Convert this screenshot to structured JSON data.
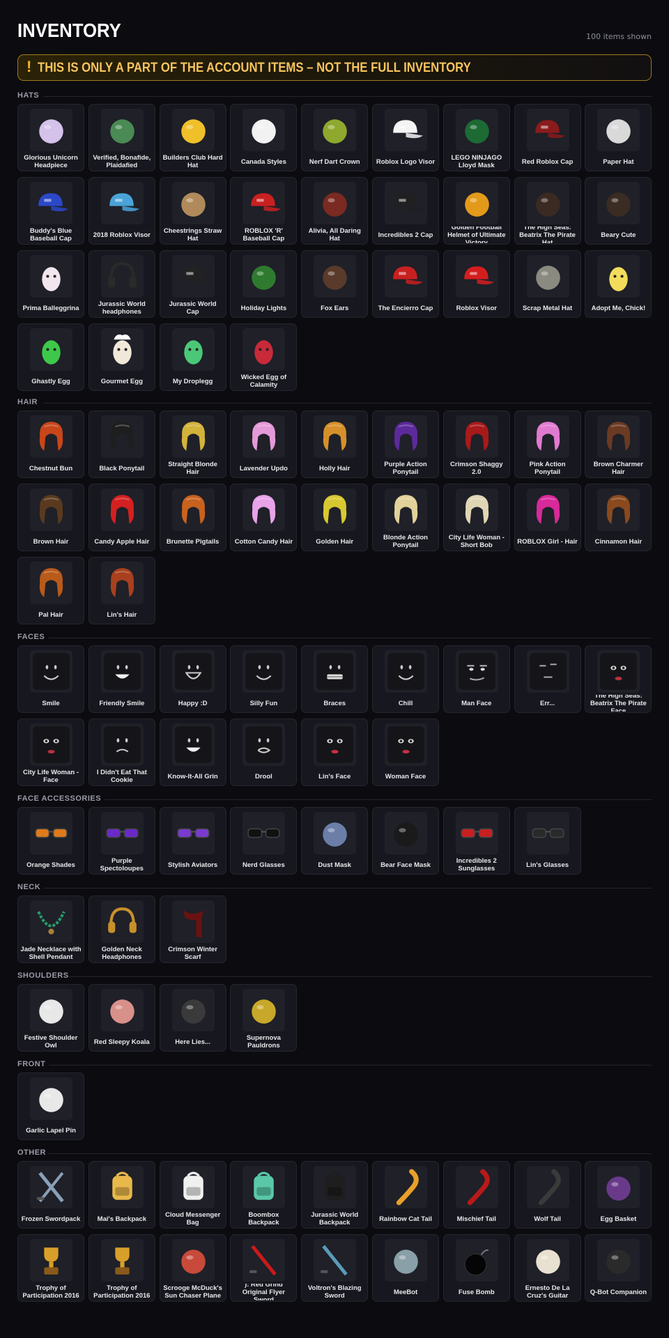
{
  "header": {
    "title": "INVENTORY",
    "count_text": "100 items shown"
  },
  "banner": {
    "icon": "!",
    "text": "THIS IS ONLY A PART OF THE ACCOUNT ITEMS – NOT THE FULL INVENTORY"
  },
  "sections": [
    {
      "title": "HATS",
      "items": [
        {
          "name": "Glorious Unicorn Headpiece",
          "icon": "unicorn-headpiece-icon",
          "color": "#d4c2ea"
        },
        {
          "name": "Verified, Bonafide, Plaidafied",
          "icon": "plaid-cap-icon",
          "color": "#4a8a54"
        },
        {
          "name": "Builders Club Hard Hat",
          "icon": "hard-hat-icon",
          "color": "#f0c02a"
        },
        {
          "name": "Canada Styles",
          "icon": "canada-cap-icon",
          "color": "#f2f2f2"
        },
        {
          "name": "Nerf Dart Crown",
          "icon": "crown-icon",
          "color": "#8fa82e"
        },
        {
          "name": "Roblox Logo Visor",
          "icon": "visor-icon",
          "color": "#f4f4f4"
        },
        {
          "name": "LEGO NINJAGO Lloyd Mask",
          "icon": "mask-icon",
          "color": "#1d6a34"
        },
        {
          "name": "Red Roblox Cap",
          "icon": "cap-icon",
          "color": "#8a1b1b"
        },
        {
          "name": "Paper Hat",
          "icon": "paper-hat-icon",
          "color": "#d9d9d9"
        },
        {
          "name": "Buddy's Blue Baseball Cap",
          "icon": "cap-icon",
          "color": "#2b48c8"
        },
        {
          "name": "2018 Roblox Visor",
          "icon": "visor-icon",
          "color": "#4aa3d8"
        },
        {
          "name": "Cheestrings Straw Hat",
          "icon": "straw-hat-icon",
          "color": "#b08a5a"
        },
        {
          "name": "ROBLOX 'R' Baseball Cap",
          "icon": "cap-icon",
          "color": "#c92020"
        },
        {
          "name": "Alivia, All Daring Hat",
          "icon": "hat-icon",
          "color": "#7a2a20"
        },
        {
          "name": "Incredibles 2 Cap",
          "icon": "cap-icon",
          "color": "#202020"
        },
        {
          "name": "Golden Football Helmet of Ultimate Victory",
          "icon": "helmet-icon",
          "color": "#e39a1a"
        },
        {
          "name": "The High Seas: Beatrix The Pirate Hat",
          "icon": "pirate-hat-icon",
          "color": "#3a2a22"
        },
        {
          "name": "Beary Cute",
          "icon": "bear-hat-icon",
          "color": "#3a2c22"
        },
        {
          "name": "Prima Balleggrina",
          "icon": "egg-icon",
          "color": "#f2e6ee"
        },
        {
          "name": "Jurassic World headphones",
          "icon": "headphones-icon",
          "color": "#2a2a2a"
        },
        {
          "name": "Jurassic World Cap",
          "icon": "cap-icon",
          "color": "#222222"
        },
        {
          "name": "Holiday Lights",
          "icon": "lights-icon",
          "color": "#2e7a2e"
        },
        {
          "name": "Fox Ears",
          "icon": "fox-ears-icon",
          "color": "#5a3a2a"
        },
        {
          "name": "The Encierro Cap",
          "icon": "cap-icon",
          "color": "#c82020"
        },
        {
          "name": "Roblox Visor",
          "icon": "visor-icon",
          "color": "#d41e1e"
        },
        {
          "name": "Scrap Metal Hat",
          "icon": "scrap-hat-icon",
          "color": "#8a8a80"
        },
        {
          "name": "Adopt Me, Chick!",
          "icon": "chick-icon",
          "color": "#f2dc5a"
        },
        {
          "name": "Ghastly Egg",
          "icon": "egg-icon",
          "color": "#3ec84a"
        },
        {
          "name": "Gourmet Egg",
          "icon": "chef-egg-icon",
          "color": "#f0e8d8"
        },
        {
          "name": "My Droplegg",
          "icon": "egg-icon",
          "color": "#4ac878"
        },
        {
          "name": "Wicked Egg of Calamity",
          "icon": "egg-icon",
          "color": "#c82a3a"
        }
      ]
    },
    {
      "title": "HAIR",
      "items": [
        {
          "name": "Chestnut Bun",
          "icon": "hair-icon",
          "color": "#c8461a"
        },
        {
          "name": "Black Ponytail",
          "icon": "hair-icon",
          "color": "#1e1e1e"
        },
        {
          "name": "Straight Blonde Hair",
          "icon": "hair-icon",
          "color": "#d2b23a"
        },
        {
          "name": "Lavender Updo",
          "icon": "hair-icon",
          "color": "#e49ad8"
        },
        {
          "name": "Holly Hair",
          "icon": "hair-icon",
          "color": "#d6902a"
        },
        {
          "name": "Purple Action Ponytail",
          "icon": "hair-icon",
          "color": "#5c2a9a"
        },
        {
          "name": "Crimson Shaggy 2.0",
          "icon": "hair-icon",
          "color": "#a81a1a"
        },
        {
          "name": "Pink Action Ponytail",
          "icon": "hair-icon",
          "color": "#e07ad0"
        },
        {
          "name": "Brown Charmer Hair",
          "icon": "hair-icon",
          "color": "#6a3a22"
        },
        {
          "name": "Brown Hair",
          "icon": "hair-icon",
          "color": "#5a3a1e"
        },
        {
          "name": "Candy Apple Hair",
          "icon": "hair-icon",
          "color": "#d42020"
        },
        {
          "name": "Brunette Pigtails",
          "icon": "hair-icon",
          "color": "#c8621e"
        },
        {
          "name": "Cotton Candy Hair",
          "icon": "hair-icon",
          "color": "#e8a2e8"
        },
        {
          "name": "Golden Hair",
          "icon": "hair-icon",
          "color": "#d8c830"
        },
        {
          "name": "Blonde Action Ponytail",
          "icon": "hair-icon",
          "color": "#e2d29a"
        },
        {
          "name": "City Life Woman - Short Bob",
          "icon": "hair-icon",
          "color": "#e0d6b4"
        },
        {
          "name": "ROBLOX Girl - Hair",
          "icon": "hair-icon",
          "color": "#d82a9a"
        },
        {
          "name": "Cinnamon Hair",
          "icon": "hair-icon",
          "color": "#8a4a1e"
        },
        {
          "name": "Pal Hair",
          "icon": "hair-icon",
          "color": "#b85a1a"
        },
        {
          "name": "Lin's Hair",
          "icon": "hair-icon",
          "color": "#a8401e"
        }
      ]
    },
    {
      "title": "FACES",
      "items": [
        {
          "name": "Smile",
          "icon": "face-smile-icon",
          "color": "#000000"
        },
        {
          "name": "Friendly Smile",
          "icon": "face-grin-icon",
          "color": "#000000"
        },
        {
          "name": "Happy :D",
          "icon": "face-happy-icon",
          "color": "#000000"
        },
        {
          "name": "Silly Fun",
          "icon": "face-silly-icon",
          "color": "#000000"
        },
        {
          "name": "Braces",
          "icon": "face-braces-icon",
          "color": "#000000"
        },
        {
          "name": "Chill",
          "icon": "face-chill-icon",
          "color": "#000000"
        },
        {
          "name": "Man Face",
          "icon": "face-man-icon",
          "color": "#000000"
        },
        {
          "name": "Err...",
          "icon": "face-err-icon",
          "color": "#000000"
        },
        {
          "name": "The High Seas: Beatrix The Pirate Face",
          "icon": "face-pirate-icon",
          "color": "#b83040"
        },
        {
          "name": "City Life Woman - Face",
          "icon": "face-woman-icon",
          "color": "#000000"
        },
        {
          "name": "I Didn't Eat That Cookie",
          "icon": "face-cookie-icon",
          "color": "#000000"
        },
        {
          "name": "Know-It-All Grin",
          "icon": "face-grin-icon",
          "color": "#000000"
        },
        {
          "name": "Drool",
          "icon": "face-drool-icon",
          "color": "#000000"
        },
        {
          "name": "Lin's Face",
          "icon": "face-lin-icon",
          "color": "#c83040"
        },
        {
          "name": "Woman Face",
          "icon": "face-woman-icon",
          "color": "#c83040"
        }
      ]
    },
    {
      "title": "FACE ACCESSORIES",
      "items": [
        {
          "name": "Orange Shades",
          "icon": "glasses-icon",
          "color": "#e07a1a"
        },
        {
          "name": "Purple Spectoloupes",
          "icon": "glasses-icon",
          "color": "#6a2ac8"
        },
        {
          "name": "Stylish Aviators",
          "icon": "glasses-icon",
          "color": "#7a3ad0"
        },
        {
          "name": "Nerd Glasses",
          "icon": "glasses-icon",
          "color": "#111111"
        },
        {
          "name": "Dust Mask",
          "icon": "dust-mask-icon",
          "color": "#6a7ea8"
        },
        {
          "name": "Bear Face Mask",
          "icon": "bear-mask-icon",
          "color": "#1a1a1a"
        },
        {
          "name": "Incredibles 2 Sunglasses",
          "icon": "glasses-icon",
          "color": "#c82020"
        },
        {
          "name": "Lin's Glasses",
          "icon": "glasses-icon",
          "color": "#2a2a2a"
        }
      ]
    },
    {
      "title": "NECK",
      "items": [
        {
          "name": "Jade Necklace with Shell Pendant",
          "icon": "necklace-icon",
          "color": "#2a9a6a"
        },
        {
          "name": "Golden Neck Headphones",
          "icon": "headphones-icon",
          "color": "#c8902a"
        },
        {
          "name": "Crimson Winter Scarf",
          "icon": "scarf-icon",
          "color": "#6a1212"
        }
      ]
    },
    {
      "title": "SHOULDERS",
      "items": [
        {
          "name": "Festive Shoulder Owl",
          "icon": "owl-icon",
          "color": "#e8e8e8"
        },
        {
          "name": "Red Sleepy Koala",
          "icon": "koala-icon",
          "color": "#d8908a"
        },
        {
          "name": "Here Lies...",
          "icon": "creature-icon",
          "color": "#3a3a3a"
        },
        {
          "name": "Supernova Pauldrons",
          "icon": "pauldrons-icon",
          "color": "#c8a82a"
        }
      ]
    },
    {
      "title": "FRONT",
      "items": [
        {
          "name": "Garlic Lapel Pin",
          "icon": "garlic-pin-icon",
          "color": "#e8e8e8"
        }
      ]
    },
    {
      "title": "OTHER",
      "items": [
        {
          "name": "Frozen Swordpack",
          "icon": "swordpack-icon",
          "color": "#8aa0b8"
        },
        {
          "name": "Mai's Backpack",
          "icon": "backpack-icon",
          "color": "#e8b84a"
        },
        {
          "name": "Cloud Messenger Bag",
          "icon": "cloud-bag-icon",
          "color": "#f0f0f0"
        },
        {
          "name": "Boombox Backpack",
          "icon": "boombox-icon",
          "color": "#5ac8a8"
        },
        {
          "name": "Jurassic World Backpack",
          "icon": "backpack-icon",
          "color": "#1e1e1e"
        },
        {
          "name": "Rainbow Cat Tail",
          "icon": "tail-icon",
          "color": "#e8a02a"
        },
        {
          "name": "Mischief Tail",
          "icon": "tail-icon",
          "color": "#b81a1a"
        },
        {
          "name": "Wolf Tail",
          "icon": "tail-icon",
          "color": "#3a3a3a"
        },
        {
          "name": "Egg Basket",
          "icon": "basket-icon",
          "color": "#6a3a8a"
        },
        {
          "name": "Trophy of Participation 2016",
          "icon": "trophy-icon",
          "color": "#d8a02a"
        },
        {
          "name": "Trophy of Participation 2016",
          "icon": "trophy-icon",
          "color": "#d8a02a"
        },
        {
          "name": "Scrooge McDuck's Sun Chaser Plane",
          "icon": "plane-icon",
          "color": "#c84a3a"
        },
        {
          "name": "): Red Grind Original Flyer Sword",
          "icon": "sword-icon",
          "color": "#c81a1a"
        },
        {
          "name": "Voltron's Blazing Sword",
          "icon": "sword-icon",
          "color": "#5a9ab8"
        },
        {
          "name": "MeeBot",
          "icon": "robot-icon",
          "color": "#8aa0a8"
        },
        {
          "name": "Fuse Bomb",
          "icon": "bomb-icon",
          "color": "#111111"
        },
        {
          "name": "Ernesto De La Cruz's Guitar",
          "icon": "guitar-icon",
          "color": "#e8e0d0"
        },
        {
          "name": "Q-Bot Companion",
          "icon": "qbot-icon",
          "color": "#2a2a2a"
        }
      ]
    }
  ]
}
